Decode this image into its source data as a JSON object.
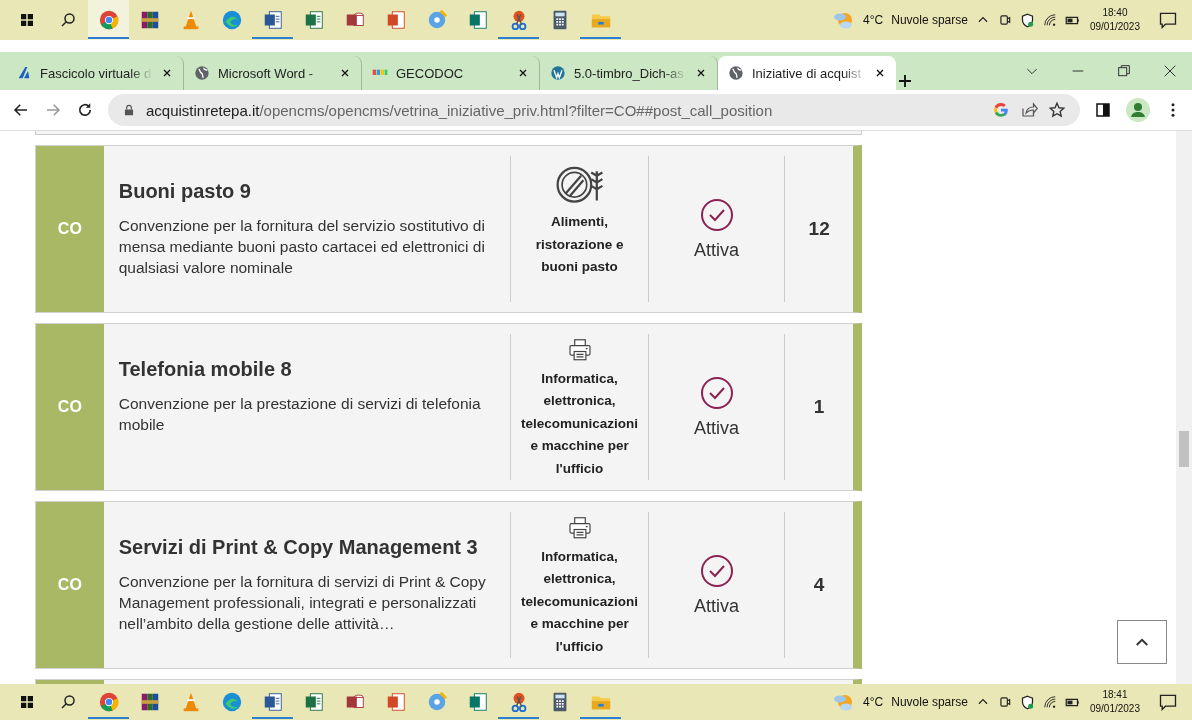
{
  "taskbar_top": {
    "apps": [
      {
        "kind": "browser",
        "running": true,
        "selected": true
      },
      {
        "kind": "archive",
        "running": false,
        "selected": false
      },
      {
        "kind": "cone",
        "running": false,
        "selected": false
      },
      {
        "kind": "wave",
        "running": false,
        "selected": false
      },
      {
        "kind": "document",
        "running": true,
        "selected": false
      },
      {
        "kind": "spreadsheet",
        "running": false,
        "selected": false
      },
      {
        "kind": "database",
        "running": false,
        "selected": false
      },
      {
        "kind": "slides",
        "running": false,
        "selected": false
      },
      {
        "kind": "disc",
        "running": false,
        "selected": false
      },
      {
        "kind": "publication",
        "running": false,
        "selected": false
      },
      {
        "kind": "scissors",
        "running": true,
        "selected": false
      },
      {
        "kind": "calculator",
        "running": false,
        "selected": false
      },
      {
        "kind": "folder",
        "running": true,
        "selected": false
      }
    ],
    "temperature": "4°C",
    "weather": "Nuvole sparse",
    "time": "18:40",
    "date": "09/01/2023"
  },
  "browser": {
    "tabs": [
      {
        "title": "Fascicolo virtuale d",
        "kind": "swoosh",
        "selected": false
      },
      {
        "title": "Microsoft Word -",
        "kind": "globe",
        "selected": false
      },
      {
        "title": "GECODOC",
        "kind": "blocks",
        "selected": false
      },
      {
        "title": "5.0-timbro_Dich-as",
        "kind": "wp",
        "selected": false
      },
      {
        "title": "Iniziative di acquist",
        "kind": "globe",
        "selected": true
      }
    ],
    "url_host": "acquistinretepa.it",
    "url_path": "/opencms/opencms/vetrina_iniziative_priv.html?filter=CO##post_call_position"
  },
  "cards": [
    {
      "code": "CO",
      "title": "Buoni pasto 9",
      "description": "Convenzione per la fornitura del servizio sostitutivo di mensa mediante buoni pasto cartacei ed elettronici di qualsiasi valore nominale",
      "kind": "food",
      "category": "Alimenti, ristorazione e buoni pasto",
      "status": "Attiva",
      "count": "12"
    },
    {
      "code": "CO",
      "title": "Telefonia mobile 8",
      "description": "Convenzione per la prestazione di servizi di telefonia mobile",
      "kind": "printer",
      "category": "Informatica, elettronica, telecomunicazioni e macchine per l'ufficio",
      "status": "Attiva",
      "count": "1"
    },
    {
      "code": "CO",
      "title": "Servizi di Print & Copy Management 3",
      "description": "Convenzione per la fornitura di servizi di Print & Copy Management professionali, integrati e personalizzati nell’ambito della gestione delle attività…",
      "kind": "printer",
      "category": "Informatica, elettronica, telecomunicazioni e macchine per l'ufficio",
      "status": "Attiva",
      "count": "4"
    }
  ],
  "taskbar_bottom": {
    "apps": [
      {
        "kind": "browser",
        "running": true,
        "selected": false
      },
      {
        "kind": "archive",
        "running": false,
        "selected": false
      },
      {
        "kind": "cone",
        "running": false,
        "selected": false
      },
      {
        "kind": "wave",
        "running": false,
        "selected": false
      },
      {
        "kind": "document",
        "running": true,
        "selected": false
      },
      {
        "kind": "spreadsheet",
        "running": false,
        "selected": false
      },
      {
        "kind": "database",
        "running": false,
        "selected": false
      },
      {
        "kind": "slides",
        "running": false,
        "selected": false
      },
      {
        "kind": "disc",
        "running": false,
        "selected": false
      },
      {
        "kind": "publication",
        "running": false,
        "selected": false
      },
      {
        "kind": "scissors",
        "running": true,
        "selected": false
      },
      {
        "kind": "calculator",
        "running": false,
        "selected": false
      },
      {
        "kind": "folder",
        "running": true,
        "selected": false
      }
    ],
    "temperature": "4°C",
    "weather": "Nuvole sparse",
    "time": "18:41",
    "date": "09/01/2023"
  }
}
